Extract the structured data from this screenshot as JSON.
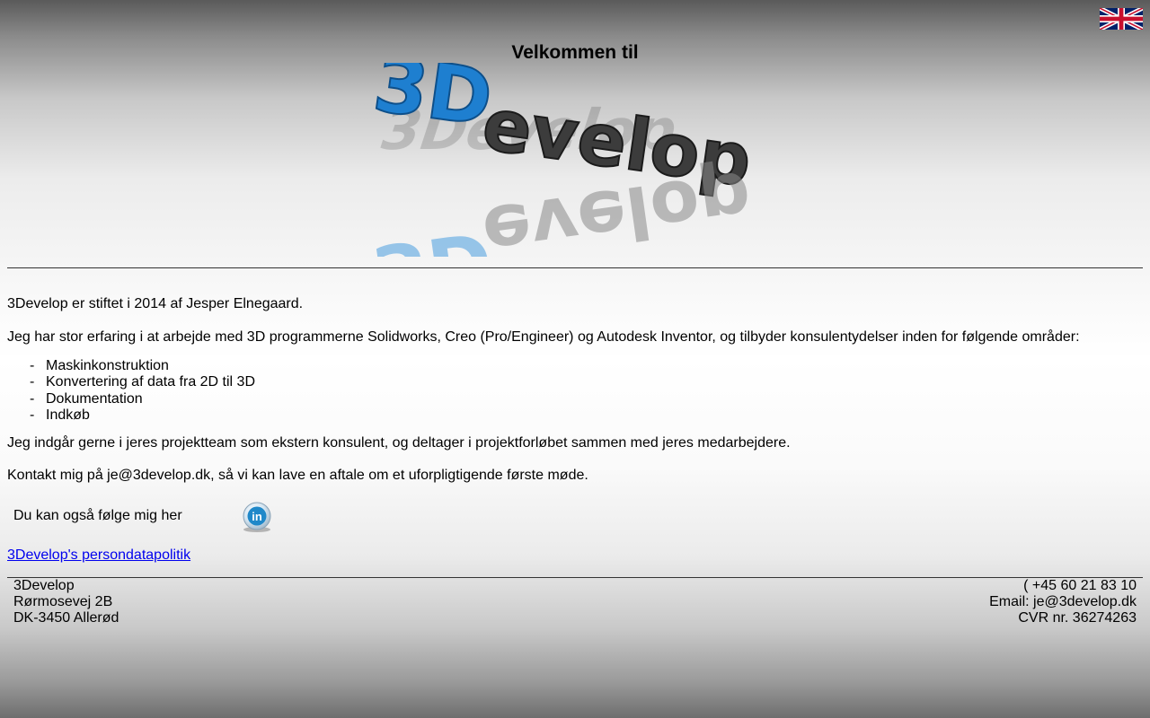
{
  "header": {
    "language_flag": "uk-flag-icon",
    "welcome": "Velkommen til",
    "logo_text": "3Develop"
  },
  "intro": {
    "founded": "3Develop er stiftet i 2014 af Jesper Elnegaard.",
    "experience": "Jeg har stor erfaring i at arbejde med 3D programmerne Solidworks, Creo (Pro/Engineer) og Autodesk Inventor, og tilbyder konsulentydelser inden for følgende områder:",
    "services": [
      "Maskinkonstruktion",
      "Konvertering af data fra 2D til 3D",
      "Dokumentation",
      "Indkøb"
    ],
    "bullet": "-",
    "team": "Jeg indgår gerne i jeres projektteam som ekstern konsulent, og deltager i projektforløbet sammen med jeres medarbejdere.",
    "contact": "Kontakt mig på je@3develop.dk, så vi kan lave en aftale om et uforpligtigende første møde."
  },
  "social": {
    "follow_text": "Du kan også følge mig her",
    "linkedin_label": "in"
  },
  "privacy_link": "3Develop's persondatapolitik",
  "footer": {
    "company": "3Develop",
    "street": "Rørmosevej 2B",
    "city": "DK-3450 Allerød",
    "phone": "( +45 60 21 83 10",
    "email": "Email: je@3develop.dk",
    "cvr": "CVR nr. 36274263"
  },
  "colors": {
    "logo_blue": "#1e7fd0",
    "logo_gray": "#3c3c3c",
    "link": "#0000ee"
  }
}
